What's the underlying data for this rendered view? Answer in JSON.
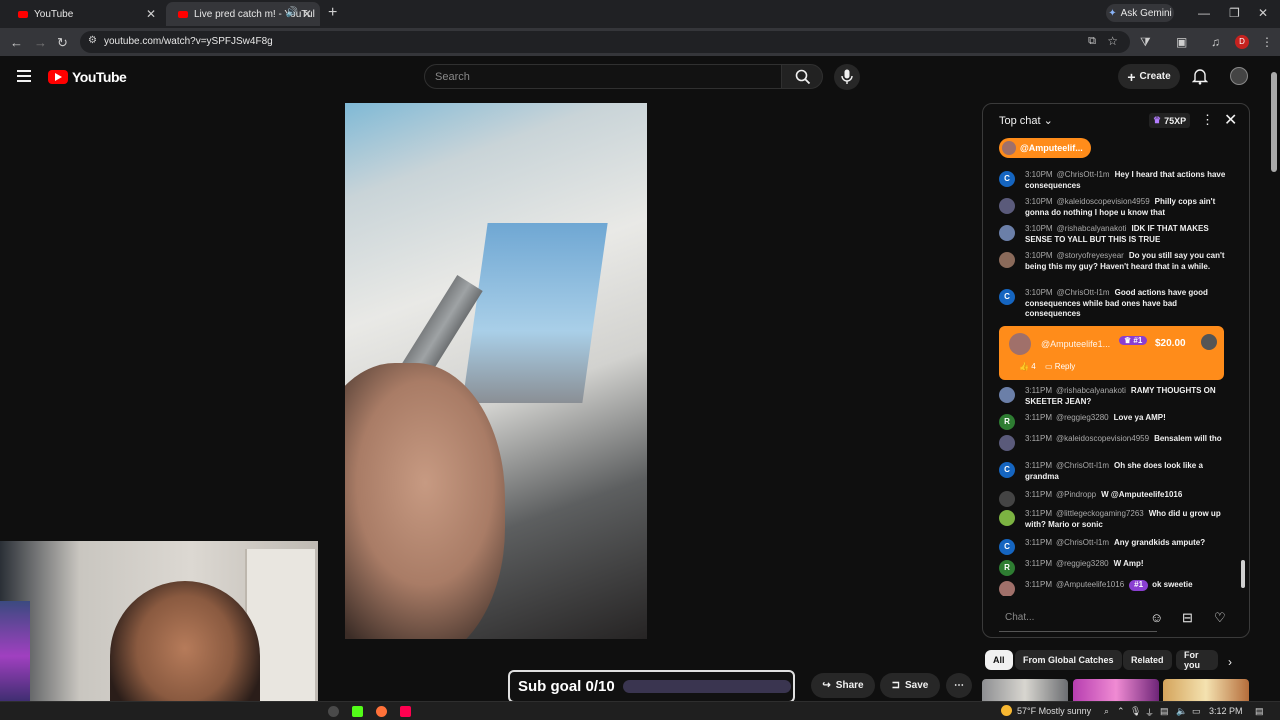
{
  "browser": {
    "tabs": [
      {
        "title": "YouTube",
        "active": false
      },
      {
        "title": "Live pred catch m! - YouTul",
        "active": true
      }
    ],
    "ask_gemini": "Ask Gemini",
    "url": "youtube.com/watch?v=ySPFJSw4F8g",
    "profile_initial": "D"
  },
  "header": {
    "logo_text": "YouTube",
    "search_placeholder": "Search",
    "create_label": "Create"
  },
  "video": {
    "sub_goal": "Sub goal 0/10",
    "sub_goal_progress": 0,
    "share_label": "Share",
    "save_label": "Save"
  },
  "chat": {
    "title": "Top chat",
    "xp": "75XP",
    "pinned_name": "@Amputeelif...",
    "input_placeholder": "Chat...",
    "messages": [
      {
        "time": "3:10PM",
        "author": "@ChrisOtt-l1m",
        "text": "Hey I heard that actions have consequences",
        "avatar": "C",
        "color": "#1565c0"
      },
      {
        "time": "3:10PM",
        "author": "@kaleidoscopevision4959",
        "text": "Philly cops ain't gonna do nothing I hope u know that",
        "avatar": "",
        "color": "#5a5a7a"
      },
      {
        "time": "3:10PM",
        "author": "@rishabcalyanakoti",
        "text": "IDK IF THAT MAKES SENSE TO YALL BUT THIS IS TRUE",
        "avatar": "",
        "color": "#6b7fa8"
      },
      {
        "time": "3:10PM",
        "author": "@storyofreyesyear",
        "text": "Do you still say you can't being this my guy? Haven't heard that in a while.",
        "avatar": "",
        "color": "#8a6a5a"
      },
      {
        "time": "3:10PM",
        "author": "@ChrisOtt-l1m",
        "text": "Good actions have good consequences while bad ones have bad consequences",
        "avatar": "C",
        "color": "#1565c0"
      },
      {
        "time": "3:11PM",
        "author": "@rishabcalyanakoti",
        "text": "RAMY THOUGHTS ON SKEETER JEAN?",
        "avatar": "",
        "color": "#6b7fa8"
      },
      {
        "time": "3:11PM",
        "author": "@reggieg3280",
        "text": "Love ya AMP!",
        "avatar": "R",
        "color": "#2e7d32"
      },
      {
        "time": "3:11PM",
        "author": "@kaleidoscopevision4959",
        "text": "Bensalem will tho",
        "avatar": "",
        "color": "#5a5a7a"
      },
      {
        "time": "3:11PM",
        "author": "@ChrisOtt-l1m",
        "text": "Oh she does look like a grandma",
        "avatar": "C",
        "color": "#1565c0"
      },
      {
        "time": "3:11PM",
        "author": "@Pindropp",
        "text": "W @Amputeelife1016",
        "avatar": "",
        "color": "#444"
      },
      {
        "time": "3:11PM",
        "author": "@littlegeckogaming7263",
        "text": "Who did u grow up with? Mario or sonic",
        "avatar": "",
        "color": "#7cb342"
      },
      {
        "time": "3:11PM",
        "author": "@ChrisOtt-l1m",
        "text": "Any grandkids ampute?",
        "avatar": "C",
        "color": "#1565c0"
      },
      {
        "time": "3:11PM",
        "author": "@reggieg3280",
        "text": "W Amp!",
        "avatar": "R",
        "color": "#2e7d32"
      },
      {
        "time": "3:11PM",
        "author": "@Amputeelife1016",
        "text": "ok sweetie",
        "avatar": "",
        "color": "#a0706a",
        "badge": "#1"
      }
    ],
    "superchat": {
      "name": "@Amputeelife1...",
      "rank": "#1",
      "amount": "$20.00",
      "likes": "4",
      "reply": "Reply"
    }
  },
  "chips": [
    "All",
    "From Global Catches",
    "Related",
    "For you"
  ],
  "taskbar": {
    "weather": "57°F  Mostly sunny",
    "time": "3:12 PM"
  },
  "colors": {
    "youtube_red": "#ff0000",
    "superchat_orange": "#ff8c1a",
    "member_purple": "#8a3fd1"
  }
}
